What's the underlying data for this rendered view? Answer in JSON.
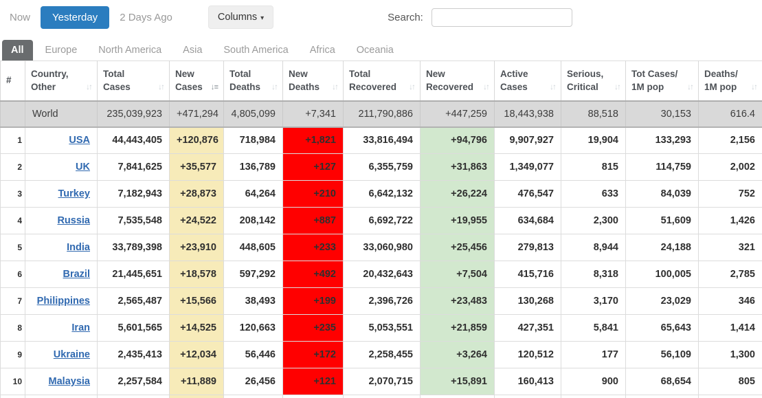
{
  "toolbar": {
    "now_label": "Now",
    "yesterday_label": "Yesterday",
    "two_days_ago_label": "2 Days Ago",
    "columns_label": "Columns",
    "columns_caret": "▾",
    "search_label": "Search:",
    "search_value": ""
  },
  "tabs": {
    "active": "All",
    "items": [
      {
        "label": "All"
      },
      {
        "label": "Europe"
      },
      {
        "label": "North America"
      },
      {
        "label": "Asia"
      },
      {
        "label": "South America"
      },
      {
        "label": "Africa"
      },
      {
        "label": "Oceania"
      }
    ]
  },
  "colors": {
    "accent_blue": "#2b7dbf",
    "link_blue": "#3069b0",
    "active_tab_gray": "#696c6e",
    "new_cases_yellow": "#f7ebb9",
    "new_deaths_red": "#ff0000",
    "new_recovered_green": "#d2e8ce",
    "world_row_gray": "#d9d9d9"
  },
  "table": {
    "columns": [
      {
        "key": "rank",
        "l1": "",
        "l2": "#",
        "sort": "none"
      },
      {
        "key": "country",
        "l1": "Country,",
        "l2": "Other",
        "sort": "both"
      },
      {
        "key": "total_cases",
        "l1": "Total",
        "l2": "Cases",
        "sort": "both"
      },
      {
        "key": "new_cases",
        "l1": "New",
        "l2": "Cases",
        "sort": "desc"
      },
      {
        "key": "total_deaths",
        "l1": "Total",
        "l2": "Deaths",
        "sort": "both"
      },
      {
        "key": "new_deaths",
        "l1": "New",
        "l2": "Deaths",
        "sort": "both"
      },
      {
        "key": "total_recovered",
        "l1": "Total",
        "l2": "Recovered",
        "sort": "both"
      },
      {
        "key": "new_recovered",
        "l1": "New",
        "l2": "Recovered",
        "sort": "both"
      },
      {
        "key": "active_cases",
        "l1": "Active",
        "l2": "Cases",
        "sort": "both"
      },
      {
        "key": "serious_critical",
        "l1": "Serious,",
        "l2": "Critical",
        "sort": "both"
      },
      {
        "key": "tot_cases_1m",
        "l1": "Tot Cases/",
        "l2": "1M pop",
        "sort": "both"
      },
      {
        "key": "deaths_1m",
        "l1": "Deaths/",
        "l2": "1M pop",
        "sort": "both"
      }
    ],
    "world": {
      "country": "World",
      "total_cases": "235,039,923",
      "new_cases": "+471,294",
      "total_deaths": "4,805,099",
      "new_deaths": "+7,341",
      "total_recovered": "211,790,886",
      "new_recovered": "+447,259",
      "active_cases": "18,443,938",
      "serious_critical": "88,518",
      "tot_cases_1m": "30,153",
      "deaths_1m": "616.4"
    },
    "rows": [
      {
        "rank": "1",
        "country": "USA",
        "total_cases": "44,443,405",
        "new_cases": "+120,876",
        "total_deaths": "718,984",
        "new_deaths": "+1,821",
        "total_recovered": "33,816,494",
        "new_recovered": "+94,796",
        "active_cases": "9,907,927",
        "serious_critical": "19,904",
        "tot_cases_1m": "133,293",
        "deaths_1m": "2,156"
      },
      {
        "rank": "2",
        "country": "UK",
        "total_cases": "7,841,625",
        "new_cases": "+35,577",
        "total_deaths": "136,789",
        "new_deaths": "+127",
        "total_recovered": "6,355,759",
        "new_recovered": "+31,863",
        "active_cases": "1,349,077",
        "serious_critical": "815",
        "tot_cases_1m": "114,759",
        "deaths_1m": "2,002"
      },
      {
        "rank": "3",
        "country": "Turkey",
        "total_cases": "7,182,943",
        "new_cases": "+28,873",
        "total_deaths": "64,264",
        "new_deaths": "+210",
        "total_recovered": "6,642,132",
        "new_recovered": "+26,224",
        "active_cases": "476,547",
        "serious_critical": "633",
        "tot_cases_1m": "84,039",
        "deaths_1m": "752"
      },
      {
        "rank": "4",
        "country": "Russia",
        "total_cases": "7,535,548",
        "new_cases": "+24,522",
        "total_deaths": "208,142",
        "new_deaths": "+887",
        "total_recovered": "6,692,722",
        "new_recovered": "+19,955",
        "active_cases": "634,684",
        "serious_critical": "2,300",
        "tot_cases_1m": "51,609",
        "deaths_1m": "1,426"
      },
      {
        "rank": "5",
        "country": "India",
        "total_cases": "33,789,398",
        "new_cases": "+23,910",
        "total_deaths": "448,605",
        "new_deaths": "+233",
        "total_recovered": "33,060,980",
        "new_recovered": "+25,456",
        "active_cases": "279,813",
        "serious_critical": "8,944",
        "tot_cases_1m": "24,188",
        "deaths_1m": "321"
      },
      {
        "rank": "6",
        "country": "Brazil",
        "total_cases": "21,445,651",
        "new_cases": "+18,578",
        "total_deaths": "597,292",
        "new_deaths": "+492",
        "total_recovered": "20,432,643",
        "new_recovered": "+7,504",
        "active_cases": "415,716",
        "serious_critical": "8,318",
        "tot_cases_1m": "100,005",
        "deaths_1m": "2,785"
      },
      {
        "rank": "7",
        "country": "Philippines",
        "total_cases": "2,565,487",
        "new_cases": "+15,566",
        "total_deaths": "38,493",
        "new_deaths": "+199",
        "total_recovered": "2,396,726",
        "new_recovered": "+23,483",
        "active_cases": "130,268",
        "serious_critical": "3,170",
        "tot_cases_1m": "23,029",
        "deaths_1m": "346"
      },
      {
        "rank": "8",
        "country": "Iran",
        "total_cases": "5,601,565",
        "new_cases": "+14,525",
        "total_deaths": "120,663",
        "new_deaths": "+235",
        "total_recovered": "5,053,551",
        "new_recovered": "+21,859",
        "active_cases": "427,351",
        "serious_critical": "5,841",
        "tot_cases_1m": "65,643",
        "deaths_1m": "1,414"
      },
      {
        "rank": "9",
        "country": "Ukraine",
        "total_cases": "2,435,413",
        "new_cases": "+12,034",
        "total_deaths": "56,446",
        "new_deaths": "+172",
        "total_recovered": "2,258,455",
        "new_recovered": "+3,264",
        "active_cases": "120,512",
        "serious_critical": "177",
        "tot_cases_1m": "56,109",
        "deaths_1m": "1,300"
      },
      {
        "rank": "10",
        "country": "Malaysia",
        "total_cases": "2,257,584",
        "new_cases": "+11,889",
        "total_deaths": "26,456",
        "new_deaths": "+121",
        "total_recovered": "2,070,715",
        "new_recovered": "+15,891",
        "active_cases": "160,413",
        "serious_critical": "900",
        "tot_cases_1m": "68,654",
        "deaths_1m": "805"
      }
    ]
  }
}
